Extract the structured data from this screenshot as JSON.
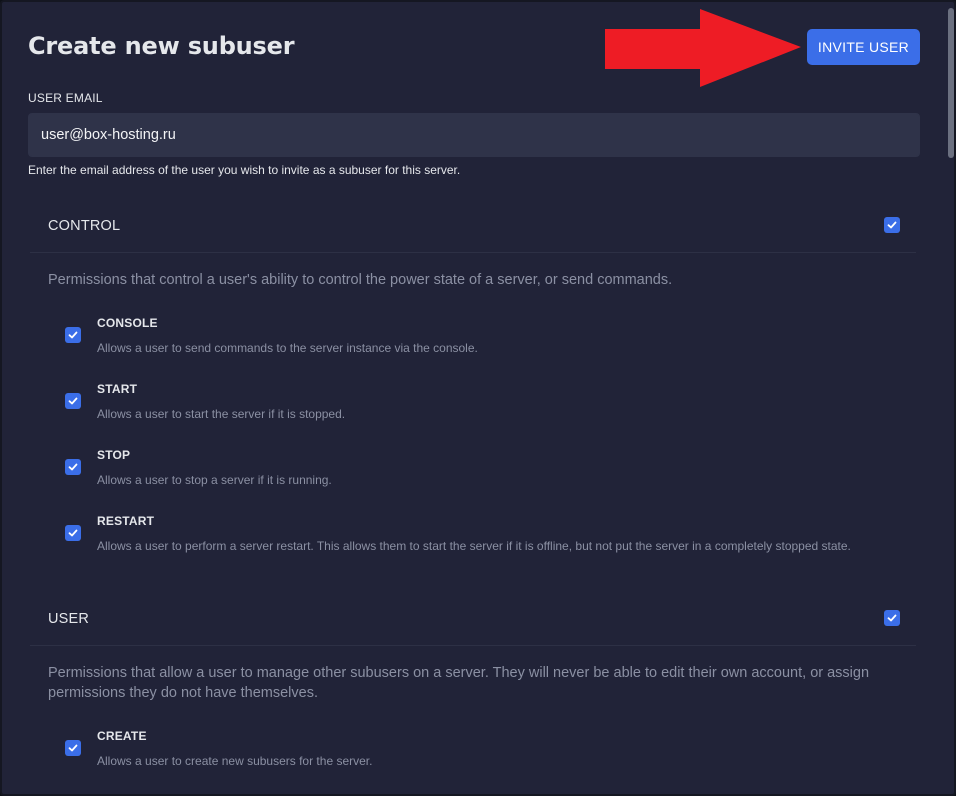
{
  "title": "Create new subuser",
  "invite_button": "INVITE USER",
  "email": {
    "label": "USER EMAIL",
    "value": "user@box-hosting.ru",
    "help": "Enter the email address of the user you wish to invite as a subuser for this server."
  },
  "colors": {
    "accent": "#3b6ee8",
    "annotation_arrow": "#ee1c25",
    "background": "#212338"
  },
  "sections": [
    {
      "title": "CONTROL",
      "checked": true,
      "description": "Permissions that control a user's ability to control the power state of a server, or send commands.",
      "permissions": [
        {
          "name": "CONSOLE",
          "description": "Allows a user to send commands to the server instance via the console.",
          "checked": true
        },
        {
          "name": "START",
          "description": "Allows a user to start the server if it is stopped.",
          "checked": true
        },
        {
          "name": "STOP",
          "description": "Allows a user to stop a server if it is running.",
          "checked": true
        },
        {
          "name": "RESTART",
          "description": "Allows a user to perform a server restart. This allows them to start the server if it is offline, but not put the server in a completely stopped state.",
          "checked": true
        }
      ]
    },
    {
      "title": "USER",
      "checked": true,
      "description": "Permissions that allow a user to manage other subusers on a server. They will never be able to edit their own account, or assign permissions they do not have themselves.",
      "permissions": [
        {
          "name": "CREATE",
          "description": "Allows a user to create new subusers for the server.",
          "checked": true
        }
      ]
    }
  ]
}
